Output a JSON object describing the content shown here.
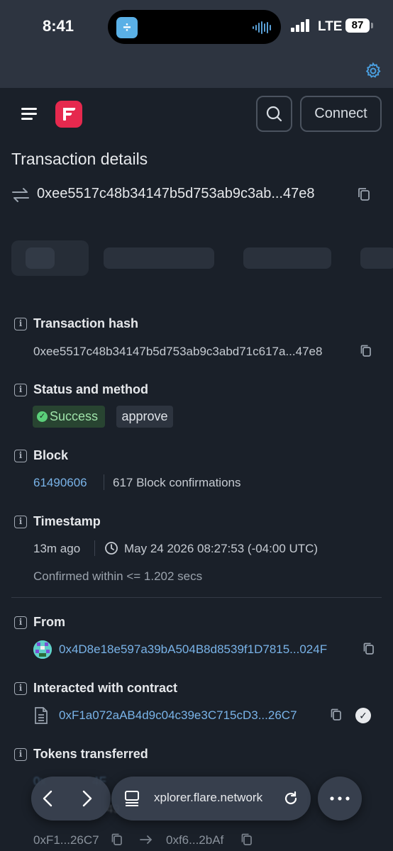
{
  "status_bar": {
    "time": "8:41",
    "network": "LTE",
    "battery": "87",
    "island_app_glyph": "÷"
  },
  "header": {
    "connect_label": "Connect",
    "brand_color": "#e6294e"
  },
  "page": {
    "title": "Transaction details",
    "hash_short": "0xee5517c48b34147b5d753ab9c3ab...47e8"
  },
  "details": {
    "tx_hash": {
      "label": "Transaction hash",
      "value": "0xee5517c48b34147b5d753ab9c3abd71c617a...47e8"
    },
    "status": {
      "label": "Status and method",
      "status_value": "Success",
      "method_value": "approve"
    },
    "block": {
      "label": "Block",
      "number": "61490606",
      "confirmations": "617 Block confirmations"
    },
    "timestamp": {
      "label": "Timestamp",
      "ago": "13m ago",
      "datetime": "May 24 2026 08:27:53 (-04:00 UTC)",
      "confirmed": "Confirmed within <= 1.202 secs"
    },
    "from": {
      "label": "From",
      "address": "0x4D8e18e597a39bA504B8d8539f1D7815...024F"
    },
    "contract": {
      "label": "Interacted with contract",
      "address": "0xF1a072aAB4d9c04c39e3C715cD3...26C7"
    },
    "tokens": {
      "label": "Tokens transferred",
      "row1_partial": "0x",
      "row1_end": "4F",
      "row2_partial": "49",
      "row3_from": "0xF1...26C7",
      "row3_to": "0xf6...2bAf"
    }
  },
  "browser_bar": {
    "url": "xplorer.flare.network"
  },
  "icons": {
    "menu": "hamburger-icon",
    "search": "search-icon",
    "settings": "gear-icon",
    "swap": "swap-arrows-icon",
    "copy": "copy-icon",
    "info": "info-icon",
    "clock": "clock-icon",
    "doc": "document-icon",
    "verified": "check-circle-icon"
  }
}
